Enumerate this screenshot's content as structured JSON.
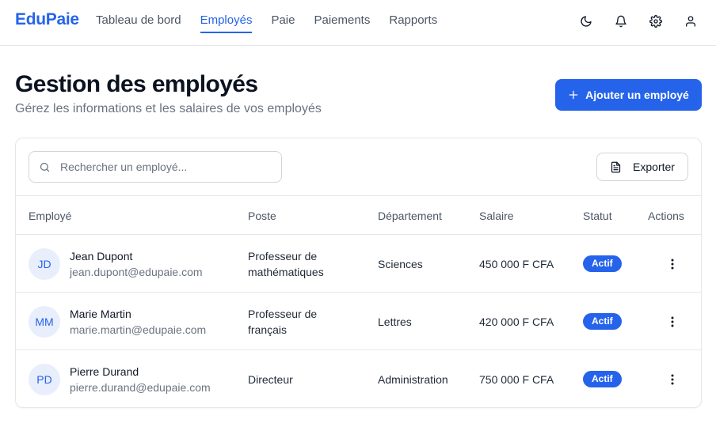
{
  "app": {
    "brand": "EduPaie"
  },
  "nav": {
    "items": [
      {
        "label": "Tableau de bord",
        "active": false
      },
      {
        "label": "Employés",
        "active": true
      },
      {
        "label": "Paie",
        "active": false
      },
      {
        "label": "Paiements",
        "active": false
      },
      {
        "label": "Rapports",
        "active": false
      }
    ]
  },
  "top_icons": [
    "moon-icon",
    "bell-icon",
    "gear-icon",
    "user-icon"
  ],
  "header": {
    "title": "Gestion des employés",
    "subtitle": "Gérez les informations et les salaires de vos employés",
    "add_button": "Ajouter un employé"
  },
  "toolbar": {
    "search_placeholder": "Rechercher un employé...",
    "search_value": "",
    "export_label": "Exporter"
  },
  "table": {
    "columns": [
      "Employé",
      "Poste",
      "Département",
      "Salaire",
      "Statut",
      "Actions"
    ],
    "rows": [
      {
        "initials": "JD",
        "name": "Jean Dupont",
        "email": "jean.dupont@edupaie.com",
        "position_line1": "Professeur de",
        "position_line2": "mathématiques",
        "department": "Sciences",
        "salary": "450 000 F CFA",
        "status": "Actif"
      },
      {
        "initials": "MM",
        "name": "Marie Martin",
        "email": "marie.martin@edupaie.com",
        "position_line1": "Professeur de",
        "position_line2": "français",
        "department": "Lettres",
        "salary": "420 000 F CFA",
        "status": "Actif"
      },
      {
        "initials": "PD",
        "name": "Pierre Durand",
        "email": "pierre.durand@edupaie.com",
        "position_line1": "Directeur",
        "position_line2": "",
        "department": "Administration",
        "salary": "750 000 F CFA",
        "status": "Actif"
      }
    ]
  },
  "colors": {
    "accent": "#2563eb",
    "text": "#111827",
    "muted": "#6b7280",
    "border": "#e5e7eb"
  }
}
